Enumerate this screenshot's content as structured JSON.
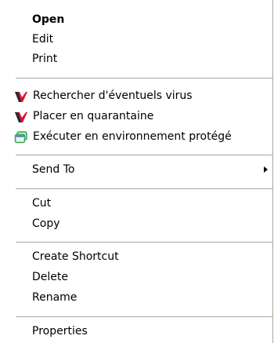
{
  "menu": {
    "items": [
      {
        "label": "Open"
      },
      {
        "label": "Edit"
      },
      {
        "label": "Print"
      },
      {
        "label": "Rechercher d'éventuels virus",
        "icon": "kaspersky-icon"
      },
      {
        "label": "Placer en quarantaine",
        "icon": "kaspersky-icon"
      },
      {
        "label": "Exécuter en environnement protégé",
        "icon": "sandbox-window-icon"
      },
      {
        "label": "Send To",
        "submenu": true
      },
      {
        "label": "Cut"
      },
      {
        "label": "Copy"
      },
      {
        "label": "Create Shortcut"
      },
      {
        "label": "Delete"
      },
      {
        "label": "Rename"
      },
      {
        "label": "Properties"
      }
    ]
  },
  "colors": {
    "kaspersky_red": "#d4143a",
    "kaspersky_dark": "#2a2a2a",
    "sandbox_green": "#3aa35a",
    "sandbox_blue": "#3a6ec8",
    "separator": "#aca899"
  }
}
